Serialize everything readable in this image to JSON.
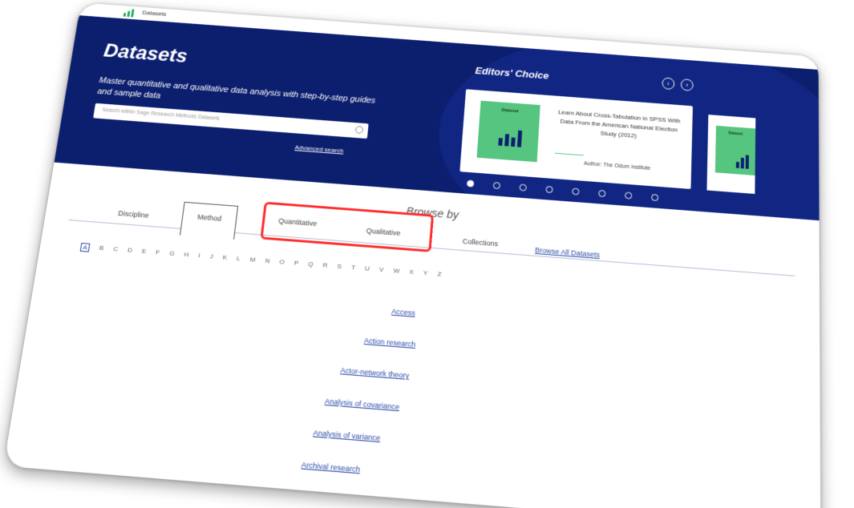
{
  "topbar": {
    "title": "Datasets"
  },
  "hero": {
    "title": "Datasets",
    "subtitle": "Master quantitative and qualitative data analysis with step-by-step guides and sample data",
    "search_placeholder": "Search within Sage Research Methods Datasets",
    "advanced_search": "Advanced search"
  },
  "editors": {
    "title": "Editors' Choice",
    "prev_label": "‹",
    "next_label": "›",
    "card": {
      "thumb_label": "Dataset",
      "text": "Learn About Cross-Tabulation in SPSS With Data From the American National Election Study (2012)",
      "author": "Author: The Odum Institute"
    },
    "peek_label": "Dataset"
  },
  "browse": {
    "heading": "Browse by",
    "tabs": [
      "Discipline",
      "Method",
      "Quantitative",
      "Qualitative",
      "Collections"
    ],
    "browse_all": "Browse All Datasets"
  },
  "alphabet": [
    "A",
    "B",
    "C",
    "D",
    "E",
    "F",
    "G",
    "H",
    "I",
    "J",
    "K",
    "L",
    "M",
    "N",
    "O",
    "P",
    "Q",
    "R",
    "S",
    "T",
    "U",
    "V",
    "W",
    "X",
    "Y",
    "Z"
  ],
  "methods": [
    "Access",
    "Action research",
    "Actor-network theory",
    "Analysis of covariance",
    "Analysis of variance",
    "Archival research"
  ]
}
